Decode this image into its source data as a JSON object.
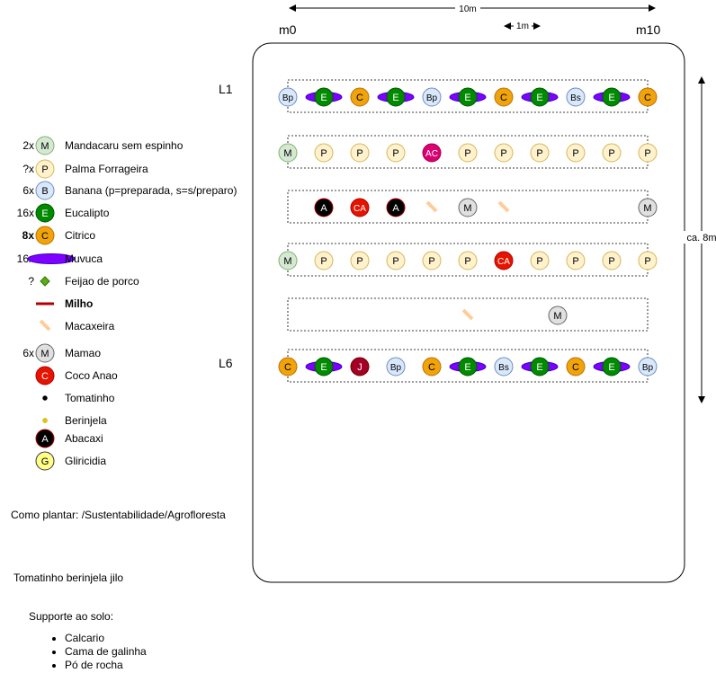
{
  "scale": {
    "total_label": "10m",
    "unit_label": "1m",
    "start_label": "m0",
    "end_label": "m10",
    "height_label": "ca. 8m"
  },
  "row_labels": {
    "first": "L1",
    "last": "L6"
  },
  "legend": [
    {
      "count": "2x",
      "symbol": "M",
      "label": "Mandacaru sem espinho",
      "shape": "circle",
      "fill": "#d5e8d4",
      "stroke": "#82b366",
      "text_color": "#000000"
    },
    {
      "count": "?x",
      "symbol": "P",
      "label": "Palma Forrageira",
      "shape": "circle",
      "fill": "#fff2cc",
      "stroke": "#d6b656",
      "text_color": "#000000"
    },
    {
      "count": "6x",
      "symbol": "B",
      "label": "Banana (p=preparada, s=s/preparo)",
      "shape": "circle",
      "fill": "#dae8fc",
      "stroke": "#6c8ebf",
      "text_color": "#000000"
    },
    {
      "count": "16x",
      "symbol": "E",
      "label": "Eucalipto",
      "shape": "circle",
      "fill": "#008a00",
      "stroke": "#005700",
      "text_color": "#ffffff"
    },
    {
      "count": "8x",
      "symbol": "C",
      "label": "Citrico",
      "shape": "circle",
      "fill": "#f0a30a",
      "stroke": "#bd7000",
      "text_color": "#000000"
    },
    {
      "count": "16x",
      "symbol": "",
      "label": "Muvuca",
      "shape": "ellipse",
      "fill": "#7f00ff",
      "stroke": "#3700cc",
      "text_color": "#000000"
    },
    {
      "count": "?",
      "symbol": "",
      "label": "Feijao de porco",
      "shape": "diamond",
      "fill": "#60a917",
      "stroke": "#2d7600",
      "text_color": "#000000"
    },
    {
      "count": "",
      "symbol": "",
      "label": "Milho",
      "shape": "bar",
      "fill": "#b20000",
      "stroke": "#b20000",
      "text_color": "#000000"
    },
    {
      "count": "",
      "symbol": "",
      "label": "Macaxeira",
      "shape": "stick",
      "fill": "#ffcc99",
      "stroke": "#ffcc99",
      "text_color": "#000000"
    },
    {
      "count": "6x",
      "symbol": "M",
      "label": "Mamao",
      "shape": "circle",
      "fill": "#e0e0e0",
      "stroke": "#666666",
      "text_color": "#000000"
    },
    {
      "count": "",
      "symbol": "C",
      "label": "Coco Anao",
      "shape": "circle",
      "fill": "#e51400",
      "stroke": "#b20000",
      "text_color": "#ffffff"
    },
    {
      "count": "",
      "symbol": "",
      "label": "Tomatinho",
      "shape": "dot",
      "fill": "#000000",
      "stroke": "#000000",
      "text_color": "#000000"
    },
    {
      "count": "",
      "symbol": "",
      "label": "Berinjela",
      "shape": "dot",
      "fill": "#e3c800",
      "stroke": "#b09500",
      "text_color": "#000000"
    },
    {
      "count": "",
      "symbol": "A",
      "label": "Abacaxi",
      "shape": "circle",
      "fill": "#000000",
      "stroke": "#b20000",
      "text_color": "#ffffff"
    },
    {
      "count": "",
      "symbol": "G",
      "label": "Gliricidia",
      "shape": "circle",
      "fill": "#ffff88",
      "stroke": "#36393d",
      "text_color": "#000000"
    }
  ],
  "rows": [
    {
      "plants": [
        {
          "pos": 0,
          "kind": "banana",
          "label": "Bp"
        },
        {
          "pos": 1,
          "kind": "eucalipto",
          "label": "E",
          "muvuca": true
        },
        {
          "pos": 2,
          "kind": "citrico",
          "label": "C"
        },
        {
          "pos": 3,
          "kind": "eucalipto",
          "label": "E",
          "muvuca": true
        },
        {
          "pos": 4,
          "kind": "banana",
          "label": "Bp"
        },
        {
          "pos": 5,
          "kind": "eucalipto",
          "label": "E",
          "muvuca": true
        },
        {
          "pos": 6,
          "kind": "citrico",
          "label": "C"
        },
        {
          "pos": 7,
          "kind": "eucalipto",
          "label": "E",
          "muvuca": true
        },
        {
          "pos": 8,
          "kind": "banana",
          "label": "Bs"
        },
        {
          "pos": 9,
          "kind": "eucalipto",
          "label": "E",
          "muvuca": true
        },
        {
          "pos": 10,
          "kind": "citrico",
          "label": "C"
        }
      ]
    },
    {
      "plants": [
        {
          "pos": 0,
          "kind": "mandacaru",
          "label": "M"
        },
        {
          "pos": 1,
          "kind": "palma",
          "label": "P"
        },
        {
          "pos": 2,
          "kind": "palma",
          "label": "P"
        },
        {
          "pos": 3,
          "kind": "palma",
          "label": "P"
        },
        {
          "pos": 4,
          "kind": "acai",
          "label": "AC"
        },
        {
          "pos": 5,
          "kind": "palma",
          "label": "P"
        },
        {
          "pos": 6,
          "kind": "palma",
          "label": "P"
        },
        {
          "pos": 7,
          "kind": "palma",
          "label": "P"
        },
        {
          "pos": 8,
          "kind": "palma",
          "label": "P"
        },
        {
          "pos": 9,
          "kind": "palma",
          "label": "P"
        },
        {
          "pos": 10,
          "kind": "palma",
          "label": "P"
        }
      ]
    },
    {
      "plants": [
        {
          "pos": 1,
          "kind": "abacaxi",
          "label": "A"
        },
        {
          "pos": 2,
          "kind": "coco",
          "label": "CA"
        },
        {
          "pos": 3,
          "kind": "abacaxi",
          "label": "A"
        },
        {
          "pos": 4,
          "kind": "macaxeira",
          "label": ""
        },
        {
          "pos": 5,
          "kind": "mamao",
          "label": "M"
        },
        {
          "pos": 6,
          "kind": "macaxeira",
          "label": ""
        },
        {
          "pos": 10,
          "kind": "mamao",
          "label": "M"
        }
      ]
    },
    {
      "plants": [
        {
          "pos": 0,
          "kind": "mandacaru",
          "label": "M"
        },
        {
          "pos": 1,
          "kind": "palma",
          "label": "P"
        },
        {
          "pos": 2,
          "kind": "palma",
          "label": "P"
        },
        {
          "pos": 3,
          "kind": "palma",
          "label": "P"
        },
        {
          "pos": 4,
          "kind": "palma",
          "label": "P"
        },
        {
          "pos": 5,
          "kind": "palma",
          "label": "P"
        },
        {
          "pos": 6,
          "kind": "coco",
          "label": "CA"
        },
        {
          "pos": 7,
          "kind": "palma",
          "label": "P"
        },
        {
          "pos": 8,
          "kind": "palma",
          "label": "P"
        },
        {
          "pos": 9,
          "kind": "palma",
          "label": "P"
        },
        {
          "pos": 10,
          "kind": "palma",
          "label": "P"
        }
      ]
    },
    {
      "plants": [
        {
          "pos": 5,
          "kind": "macaxeira",
          "label": ""
        },
        {
          "pos": 7.5,
          "kind": "mamao",
          "label": "M"
        }
      ]
    },
    {
      "plants": [
        {
          "pos": 0,
          "kind": "citrico",
          "label": "C"
        },
        {
          "pos": 1,
          "kind": "eucalipto",
          "label": "E",
          "muvuca": true
        },
        {
          "pos": 2,
          "kind": "jaca",
          "label": "J"
        },
        {
          "pos": 3,
          "kind": "banana",
          "label": "Bp"
        },
        {
          "pos": 4,
          "kind": "citrico",
          "label": "C"
        },
        {
          "pos": 5,
          "kind": "eucalipto",
          "label": "E",
          "muvuca": true
        },
        {
          "pos": 6,
          "kind": "banana",
          "label": "Bs"
        },
        {
          "pos": 7,
          "kind": "eucalipto",
          "label": "E",
          "muvuca": true
        },
        {
          "pos": 8,
          "kind": "citrico",
          "label": "C"
        },
        {
          "pos": 9,
          "kind": "eucalipto",
          "label": "E",
          "muvuca": true
        },
        {
          "pos": 10,
          "kind": "banana",
          "label": "Bp"
        }
      ]
    }
  ],
  "kinds": {
    "banana": {
      "fill": "#dae8fc",
      "stroke": "#6c8ebf",
      "text": "#000000"
    },
    "eucalipto": {
      "fill": "#008a00",
      "stroke": "#005700",
      "text": "#ffffff"
    },
    "citrico": {
      "fill": "#f0a30a",
      "stroke": "#bd7000",
      "text": "#000000"
    },
    "mandacaru": {
      "fill": "#d5e8d4",
      "stroke": "#82b366",
      "text": "#000000"
    },
    "palma": {
      "fill": "#fff2cc",
      "stroke": "#d6b656",
      "text": "#000000"
    },
    "acai": {
      "fill": "#d80073",
      "stroke": "#a50040",
      "text": "#ffffff"
    },
    "abacaxi": {
      "fill": "#000000",
      "stroke": "#b20000",
      "text": "#ffffff"
    },
    "coco": {
      "fill": "#e51400",
      "stroke": "#b20000",
      "text": "#ffffff"
    },
    "mamao": {
      "fill": "#e0e0e0",
      "stroke": "#666666",
      "text": "#000000"
    },
    "jaca": {
      "fill": "#a20025",
      "stroke": "#6f0000",
      "text": "#ffffff"
    },
    "macaxeira": {
      "fill": "#ffcc99",
      "stroke": "#ffcc99",
      "text": "#000000"
    },
    "muvuca": {
      "fill": "#7f00ff",
      "stroke": "#3700cc",
      "text": "#000000"
    }
  },
  "notes": {
    "como_plantar": "Como plantar: /Sustentabilidade/Agrofloresta",
    "tomatinho": "Tomatinho berinjela jilo",
    "suporte_title": "Supporte ao solo:",
    "suporte_items": [
      "Calcario",
      "Cama de galinha",
      "Pó de rocha"
    ]
  }
}
